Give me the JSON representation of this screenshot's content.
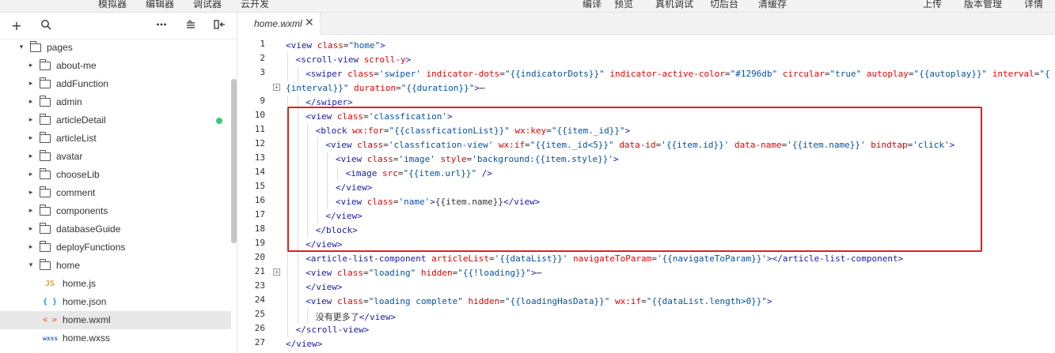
{
  "toolbar": {
    "simulator": "模拟器",
    "editor": "编辑器",
    "debugger": "调试器",
    "cloud": "云开发",
    "compile": "编译",
    "preview": "预览",
    "remote_debug": "真机调试",
    "background": "切后台",
    "clear_cache": "清缓存",
    "upload": "上传",
    "version_mgmt": "版本管理",
    "details": "详情"
  },
  "sidebar": {
    "tools": [
      "plus-icon",
      "search-icon",
      "more-icon",
      "collapse-list-icon",
      "split-icon"
    ],
    "tree": [
      {
        "label": "pages",
        "type": "folder",
        "open": true,
        "level": 0
      },
      {
        "label": "about-me",
        "type": "folder",
        "open": false,
        "level": 1
      },
      {
        "label": "addFunction",
        "type": "folder",
        "open": false,
        "level": 1
      },
      {
        "label": "admin",
        "type": "folder",
        "open": false,
        "level": 1
      },
      {
        "label": "articleDetail",
        "type": "folder",
        "open": false,
        "level": 1,
        "badge": true
      },
      {
        "label": "articleList",
        "type": "folder",
        "open": false,
        "level": 1
      },
      {
        "label": "avatar",
        "type": "folder",
        "open": false,
        "level": 1
      },
      {
        "label": "chooseLib",
        "type": "folder",
        "open": false,
        "level": 1
      },
      {
        "label": "comment",
        "type": "folder",
        "open": false,
        "level": 1
      },
      {
        "label": "components",
        "type": "folder",
        "open": false,
        "level": 1
      },
      {
        "label": "databaseGuide",
        "type": "folder",
        "open": false,
        "level": 1
      },
      {
        "label": "deployFunctions",
        "type": "folder",
        "open": false,
        "level": 1
      },
      {
        "label": "home",
        "type": "folder",
        "open": true,
        "level": 1
      },
      {
        "label": "home.js",
        "type": "js",
        "icon": "JS",
        "level": 2
      },
      {
        "label": "home.json",
        "type": "json",
        "icon": "{ }",
        "level": 2
      },
      {
        "label": "home.wxml",
        "type": "wxml",
        "icon": "< >",
        "level": 2,
        "selected": true
      },
      {
        "label": "home.wxss",
        "type": "wxss",
        "icon": "wxss",
        "level": 2
      }
    ]
  },
  "tab": {
    "label": "home.wxml",
    "close": "✕"
  },
  "editor": {
    "lines": [
      {
        "n": "1",
        "indent": 0,
        "fold": false,
        "code": [
          [
            "t",
            "<view "
          ],
          [
            "a",
            "class"
          ],
          [
            "x",
            "="
          ],
          [
            "v",
            "\"home\""
          ],
          [
            "t",
            ">"
          ]
        ]
      },
      {
        "n": "2",
        "indent": 1,
        "fold": false,
        "code": [
          [
            "t",
            "<scroll-view "
          ],
          [
            "a",
            "scroll-y"
          ],
          [
            "t",
            ">"
          ]
        ]
      },
      {
        "n": "3",
        "indent": 2,
        "fold": false,
        "code": [
          [
            "t",
            "<swiper "
          ],
          [
            "a",
            "class"
          ],
          [
            "x",
            "="
          ],
          [
            "v",
            "'swiper' "
          ],
          [
            "a",
            "indicator-dots"
          ],
          [
            "x",
            "="
          ],
          [
            "v",
            "\"{{indicatorDots}}\" "
          ],
          [
            "a",
            "indicator-active-color"
          ],
          [
            "x",
            "="
          ],
          [
            "v",
            "\"#1296db\" "
          ],
          [
            "a",
            "circular"
          ],
          [
            "x",
            "="
          ],
          [
            "v",
            "\"true\" "
          ],
          [
            "a",
            "autoplay"
          ],
          [
            "x",
            "="
          ],
          [
            "v",
            "\"{{autoplay}}\" "
          ],
          [
            "a",
            "interval"
          ],
          [
            "x",
            "="
          ],
          [
            "v",
            "\"{"
          ]
        ]
      },
      {
        "n": "",
        "indent": 0,
        "fold": true,
        "code": [
          [
            "v",
            "{interval}}\" "
          ],
          [
            "a",
            "duration"
          ],
          [
            "x",
            "="
          ],
          [
            "v",
            "\"{{duration}}\""
          ],
          [
            "t",
            ">"
          ],
          [
            "x",
            "⋯"
          ]
        ]
      },
      {
        "n": "9",
        "indent": 2,
        "fold": false,
        "code": [
          [
            "t",
            "</swiper>"
          ]
        ]
      },
      {
        "n": "10",
        "indent": 2,
        "fold": false,
        "code": [
          [
            "t",
            "<view "
          ],
          [
            "a",
            "class"
          ],
          [
            "x",
            "="
          ],
          [
            "v",
            "'classfication'"
          ],
          [
            "t",
            ">"
          ]
        ]
      },
      {
        "n": "11",
        "indent": 3,
        "fold": false,
        "code": [
          [
            "t",
            "<block "
          ],
          [
            "a",
            "wx:for"
          ],
          [
            "x",
            "="
          ],
          [
            "v",
            "\"{{classficationList}}\" "
          ],
          [
            "a",
            "wx:key"
          ],
          [
            "x",
            "="
          ],
          [
            "v",
            "\"{{item._id}}\""
          ],
          [
            "t",
            ">"
          ]
        ]
      },
      {
        "n": "12",
        "indent": 4,
        "fold": false,
        "code": [
          [
            "t",
            "<view "
          ],
          [
            "a",
            "class"
          ],
          [
            "x",
            "="
          ],
          [
            "v",
            "'classfication-view' "
          ],
          [
            "a",
            "wx:if"
          ],
          [
            "x",
            "="
          ],
          [
            "v",
            "\"{{item._id<5}}\" "
          ],
          [
            "a",
            "data-id"
          ],
          [
            "x",
            "="
          ],
          [
            "v",
            "'{{item.id}}' "
          ],
          [
            "a",
            "data-name"
          ],
          [
            "x",
            "="
          ],
          [
            "v",
            "'{{item.name}}' "
          ],
          [
            "a",
            "bindtap"
          ],
          [
            "x",
            "="
          ],
          [
            "v",
            "'click'"
          ],
          [
            "t",
            ">"
          ]
        ]
      },
      {
        "n": "13",
        "indent": 5,
        "fold": false,
        "code": [
          [
            "t",
            "<view "
          ],
          [
            "a",
            "class"
          ],
          [
            "x",
            "="
          ],
          [
            "v",
            "'image' "
          ],
          [
            "a",
            "style"
          ],
          [
            "x",
            "="
          ],
          [
            "v",
            "'background:{{item.style}}'"
          ],
          [
            "t",
            ">"
          ]
        ]
      },
      {
        "n": "14",
        "indent": 6,
        "fold": false,
        "code": [
          [
            "t",
            "<image "
          ],
          [
            "a",
            "src"
          ],
          [
            "x",
            "="
          ],
          [
            "v",
            "\"{{item.url}}\" "
          ],
          [
            "t",
            "/>"
          ]
        ]
      },
      {
        "n": "15",
        "indent": 5,
        "fold": false,
        "code": [
          [
            "t",
            "</view>"
          ]
        ]
      },
      {
        "n": "16",
        "indent": 5,
        "fold": false,
        "code": [
          [
            "t",
            "<view "
          ],
          [
            "a",
            "class"
          ],
          [
            "x",
            "="
          ],
          [
            "v",
            "'name'"
          ],
          [
            "t",
            ">"
          ],
          [
            "x",
            "{{item.name}}"
          ],
          [
            "t",
            "</view>"
          ]
        ]
      },
      {
        "n": "17",
        "indent": 4,
        "fold": false,
        "code": [
          [
            "t",
            "</view>"
          ]
        ]
      },
      {
        "n": "18",
        "indent": 3,
        "fold": false,
        "code": [
          [
            "t",
            "</block>"
          ]
        ]
      },
      {
        "n": "19",
        "indent": 2,
        "fold": false,
        "code": [
          [
            "t",
            "</view>"
          ]
        ]
      },
      {
        "n": "20",
        "indent": 2,
        "fold": false,
        "code": [
          [
            "t",
            "<article-list-component "
          ],
          [
            "a",
            "articleList"
          ],
          [
            "x",
            "="
          ],
          [
            "v",
            "'{{dataList}}' "
          ],
          [
            "a",
            "navigateToParam"
          ],
          [
            "x",
            "="
          ],
          [
            "v",
            "'{{navigateToParam}}'"
          ],
          [
            "t",
            "></article-list-component>"
          ]
        ]
      },
      {
        "n": "21",
        "indent": 2,
        "fold": true,
        "code": [
          [
            "t",
            "<view "
          ],
          [
            "a",
            "class"
          ],
          [
            "x",
            "="
          ],
          [
            "v",
            "\"loading\" "
          ],
          [
            "a",
            "hidden"
          ],
          [
            "x",
            "="
          ],
          [
            "v",
            "\"{{!loading}}\""
          ],
          [
            "t",
            ">"
          ],
          [
            "x",
            "⋯"
          ]
        ]
      },
      {
        "n": "23",
        "indent": 2,
        "fold": false,
        "code": [
          [
            "t",
            "</view>"
          ]
        ]
      },
      {
        "n": "24",
        "indent": 2,
        "fold": false,
        "code": [
          [
            "t",
            "<view "
          ],
          [
            "a",
            "class"
          ],
          [
            "x",
            "="
          ],
          [
            "v",
            "\"loading complete\" "
          ],
          [
            "a",
            "hidden"
          ],
          [
            "x",
            "="
          ],
          [
            "v",
            "\"{{loadingHasData}}\" "
          ],
          [
            "a",
            "wx:if"
          ],
          [
            "x",
            "="
          ],
          [
            "v",
            "\"{{dataList.length>0}}\""
          ],
          [
            "t",
            ">"
          ]
        ]
      },
      {
        "n": "25",
        "indent": 3,
        "fold": false,
        "code": [
          [
            "x",
            "没有更多了"
          ],
          [
            "t",
            "</view>"
          ]
        ]
      },
      {
        "n": "26",
        "indent": 1,
        "fold": false,
        "code": [
          [
            "t",
            "</scroll-view>"
          ]
        ]
      },
      {
        "n": "27",
        "indent": 0,
        "fold": false,
        "code": [
          [
            "t",
            "</view>"
          ]
        ]
      }
    ]
  },
  "colors": {
    "tag": "#1a1aa6",
    "attr": "#e50000",
    "value": "#0451a5",
    "highlight_box": "#e02020",
    "status_dot": "#3fc77a"
  }
}
